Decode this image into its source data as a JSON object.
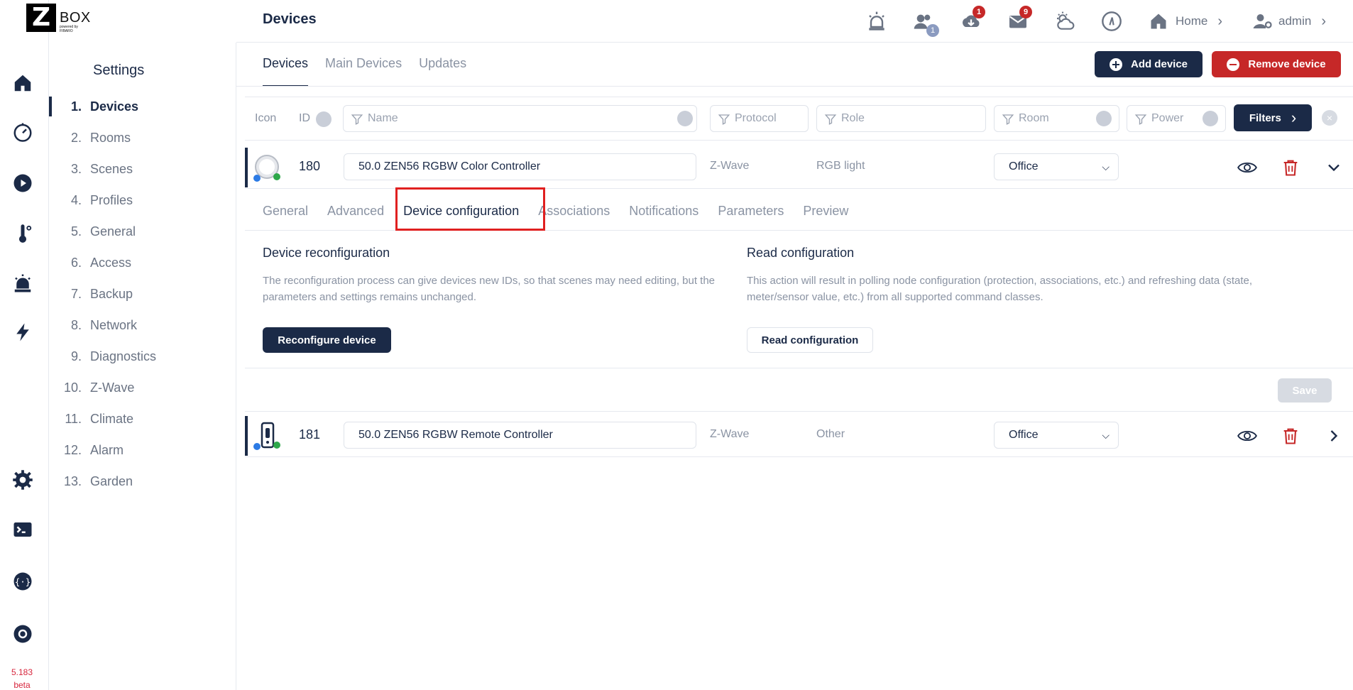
{
  "brand": {
    "logo_letter": "Z",
    "logo_text": "BOX",
    "logo_sub": "powered by FIBARO"
  },
  "version": {
    "number": "5.183",
    "tag": "beta"
  },
  "header": {
    "title": "Devices",
    "users_badge": "1",
    "updates_badge": "1",
    "messages_badge": "9",
    "home_label": "Home",
    "admin_label": "admin"
  },
  "sidebar": {
    "title": "Settings",
    "items": [
      {
        "num": "1.",
        "label": "Devices"
      },
      {
        "num": "2.",
        "label": "Rooms"
      },
      {
        "num": "3.",
        "label": "Scenes"
      },
      {
        "num": "4.",
        "label": "Profiles"
      },
      {
        "num": "5.",
        "label": "General"
      },
      {
        "num": "6.",
        "label": "Access"
      },
      {
        "num": "7.",
        "label": "Backup"
      },
      {
        "num": "8.",
        "label": "Network"
      },
      {
        "num": "9.",
        "label": "Diagnostics"
      },
      {
        "num": "10.",
        "label": "Z-Wave"
      },
      {
        "num": "11.",
        "label": "Climate"
      },
      {
        "num": "12.",
        "label": "Alarm"
      },
      {
        "num": "13.",
        "label": "Garden"
      }
    ]
  },
  "tabs": {
    "devices": "Devices",
    "main_devices": "Main Devices",
    "updates": "Updates"
  },
  "actions": {
    "add_device": "Add device",
    "remove_device": "Remove device"
  },
  "filters": {
    "icon_label": "Icon",
    "id_label": "ID",
    "name_placeholder": "Name",
    "protocol_placeholder": "Protocol",
    "role_placeholder": "Role",
    "room_placeholder": "Room",
    "power_placeholder": "Power",
    "filters_button": "Filters"
  },
  "devices": [
    {
      "id": "180",
      "name": "50.0 ZEN56 RGBW Color Controller",
      "protocol": "Z-Wave",
      "role": "RGB light",
      "room": "Office"
    },
    {
      "id": "181",
      "name": "50.0 ZEN56 RGBW Remote Controller",
      "protocol": "Z-Wave",
      "role": "Other",
      "room": "Office"
    }
  ],
  "panel": {
    "tabs": [
      "General",
      "Advanced",
      "Device configuration",
      "Associations",
      "Notifications",
      "Parameters",
      "Preview"
    ],
    "active_tab": "Device configuration",
    "reconfig": {
      "title": "Device reconfiguration",
      "desc_line1": "The reconfiguration process can give devices new IDs, so that scenes may need editing, but the",
      "desc_line2": "parameters and settings remains unchanged.",
      "button": "Reconfigure device"
    },
    "readcfg": {
      "title": "Read configuration",
      "desc_line1": "This action will result in polling node configuration (protection, associations, etc.) and refreshing data (state,",
      "desc_line2": "meter/sensor value, etc.) from all supported command classes.",
      "button": "Read configuration"
    },
    "save": "Save"
  },
  "colors": {
    "navy": "#1b2a47",
    "red": "#c62828",
    "highlight": "#e02020",
    "muted": "#8a93a3"
  }
}
